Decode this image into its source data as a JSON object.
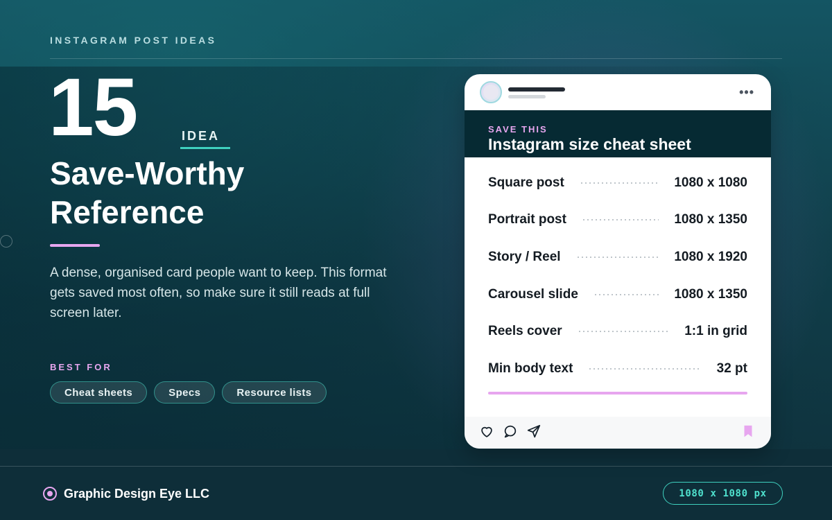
{
  "header": {
    "eyebrow": "INSTAGRAM POST IDEAS"
  },
  "hero": {
    "number": "15",
    "tag": "IDEA",
    "headline": "Save-Worthy Reference",
    "description": "A dense, organised card people want to keep. This format gets saved most often, so make sure it still reads at full screen later."
  },
  "best_for": {
    "label": "BEST FOR",
    "chips": [
      "Cheat sheets",
      "Specs",
      "Resource lists"
    ]
  },
  "card": {
    "eyebrow": "SAVE THIS",
    "title": "Instagram size cheat sheet",
    "rows": [
      {
        "label": "Square post",
        "value": "1080 x 1080"
      },
      {
        "label": "Portrait post",
        "value": "1080 x 1350"
      },
      {
        "label": "Story / Reel",
        "value": "1080 x 1920"
      },
      {
        "label": "Carousel slide",
        "value": "1080 x 1350"
      },
      {
        "label": "Reels cover",
        "value": "1:1 in grid"
      },
      {
        "label": "Min body text",
        "value": "32 pt"
      }
    ],
    "icons": [
      "heart-icon",
      "comment-icon",
      "send-icon",
      "bookmark-icon",
      "more-icon"
    ]
  },
  "footer": {
    "brand": "Graphic Design Eye LLC",
    "size": "1080 x 1080 px"
  },
  "colors": {
    "accent_teal": "#3fd1bf",
    "accent_pink": "#e7a6ef",
    "card_header": "#062a33"
  }
}
